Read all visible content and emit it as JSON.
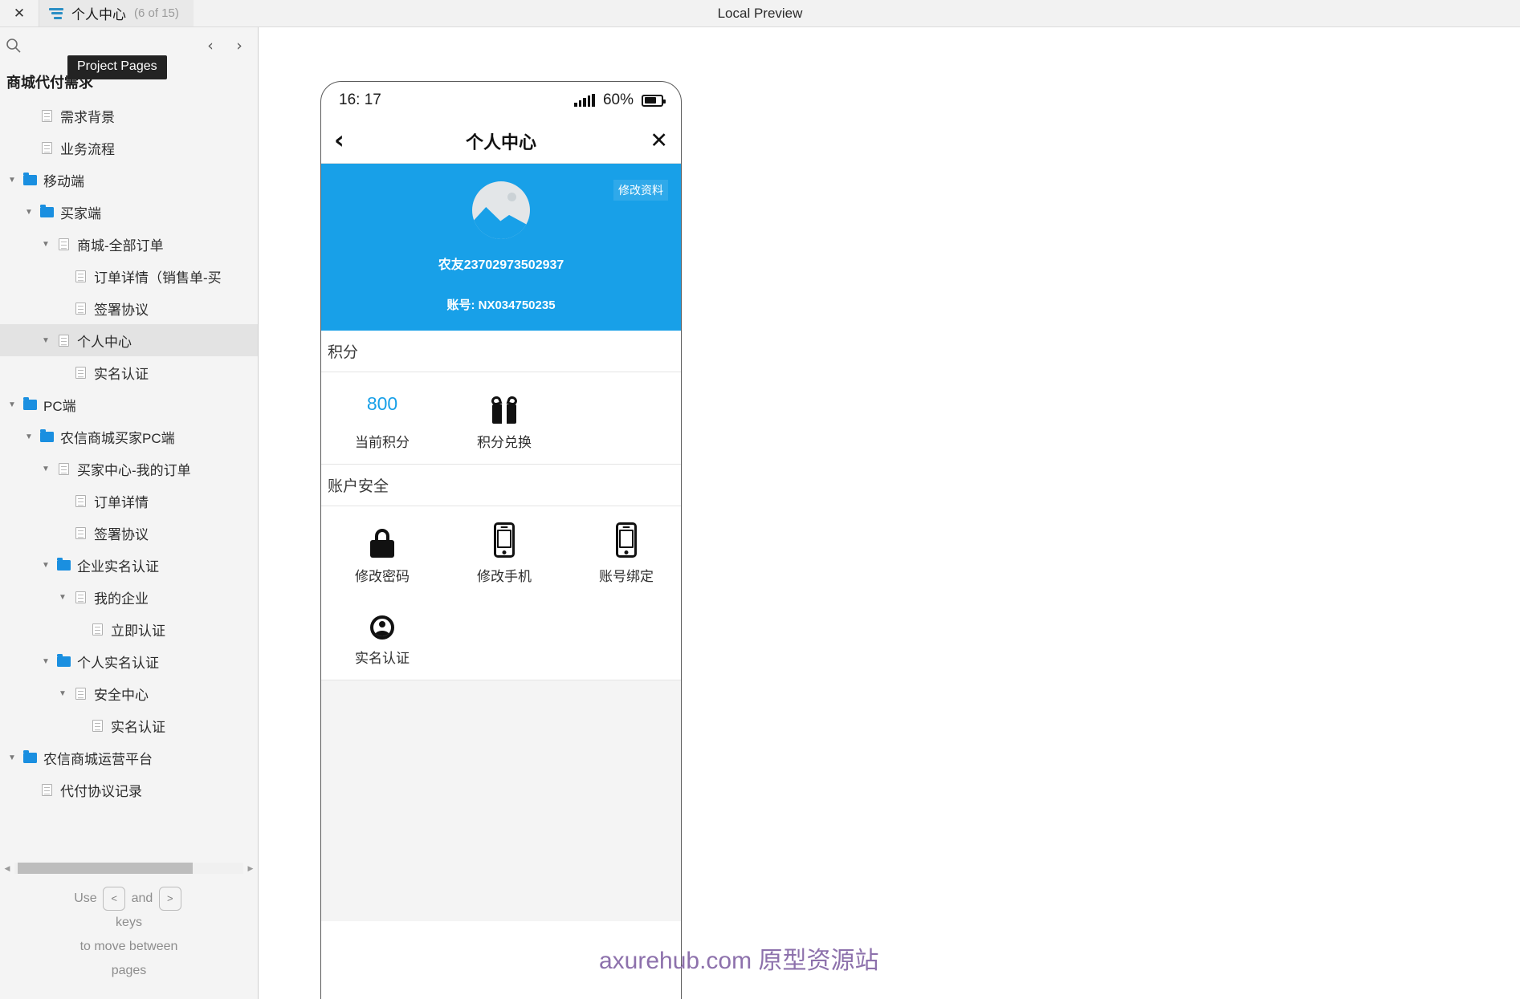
{
  "topbar": {
    "close_label": "✕",
    "tab_icon": "sitemap-icon",
    "tab_title": "个人中心",
    "tab_count": "(6 of 15)",
    "preview_label": "Local Preview"
  },
  "sidebar": {
    "tooltip": "Project Pages",
    "search_icon": "search-icon",
    "prev_arrow": "‹",
    "next_arrow": "›",
    "root_title": "商城代付需求",
    "tree": [
      {
        "label": "需求背景",
        "type": "page",
        "depth": 1,
        "twisty": "",
        "selected": false
      },
      {
        "label": "业务流程",
        "type": "page",
        "depth": 1,
        "twisty": "",
        "selected": false
      },
      {
        "label": "移动端",
        "type": "folder",
        "depth": 0,
        "twisty": "▼",
        "selected": false
      },
      {
        "label": "买家端",
        "type": "folder",
        "depth": 1,
        "twisty": "▼",
        "selected": false
      },
      {
        "label": "商城-全部订单",
        "type": "page",
        "depth": 2,
        "twisty": "▼",
        "selected": false
      },
      {
        "label": "订单详情（销售单-买",
        "type": "page",
        "depth": 3,
        "twisty": "",
        "selected": false
      },
      {
        "label": "签署协议",
        "type": "page",
        "depth": 3,
        "twisty": "",
        "selected": false
      },
      {
        "label": "个人中心",
        "type": "page",
        "depth": 2,
        "twisty": "▼",
        "selected": true
      },
      {
        "label": "实名认证",
        "type": "page",
        "depth": 3,
        "twisty": "",
        "selected": false
      },
      {
        "label": "PC端",
        "type": "folder",
        "depth": 0,
        "twisty": "▼",
        "selected": false
      },
      {
        "label": "农信商城买家PC端",
        "type": "folder",
        "depth": 1,
        "twisty": "▼",
        "selected": false
      },
      {
        "label": "买家中心-我的订单",
        "type": "page",
        "depth": 2,
        "twisty": "▼",
        "selected": false
      },
      {
        "label": "订单详情",
        "type": "page",
        "depth": 3,
        "twisty": "",
        "selected": false
      },
      {
        "label": "签署协议",
        "type": "page",
        "depth": 3,
        "twisty": "",
        "selected": false
      },
      {
        "label": "企业实名认证",
        "type": "folder",
        "depth": 2,
        "twisty": "▼",
        "selected": false
      },
      {
        "label": "我的企业",
        "type": "page",
        "depth": 3,
        "twisty": "▼",
        "selected": false
      },
      {
        "label": "立即认证",
        "type": "page",
        "depth": 4,
        "twisty": "",
        "selected": false
      },
      {
        "label": "个人实名认证",
        "type": "folder",
        "depth": 2,
        "twisty": "▼",
        "selected": false
      },
      {
        "label": "安全中心",
        "type": "page",
        "depth": 3,
        "twisty": "▼",
        "selected": false
      },
      {
        "label": "实名认证",
        "type": "page",
        "depth": 4,
        "twisty": "",
        "selected": false
      },
      {
        "label": "农信商城运营平台",
        "type": "folder",
        "depth": 0,
        "twisty": "▼",
        "selected": false
      },
      {
        "label": "代付协议记录",
        "type": "page",
        "depth": 1,
        "twisty": "",
        "selected": false
      }
    ],
    "hint_use": "Use",
    "hint_and": "and",
    "hint_key_prev": "<",
    "hint_key_next": ">",
    "hint_keys": "keys",
    "hint_line2": "to move between",
    "hint_line3": "pages"
  },
  "preview": {
    "status": {
      "time": "16: 17",
      "battery_percent": "60%",
      "signal_icon": "signal-bars-icon",
      "battery_icon": "battery-icon"
    },
    "nav": {
      "back_icon": "chevron-left-icon",
      "title": "个人中心",
      "close_icon": "close-icon"
    },
    "hero": {
      "edit_button": "修改资料",
      "avatar_icon": "image-placeholder-avatar-icon",
      "username": "农友23702973502937",
      "account": "账号: NX034750235",
      "bg_color": "#18a0e8"
    },
    "points_section": {
      "title": "积分",
      "items": [
        {
          "value": "800",
          "label": "当前积分",
          "icon": "points-value"
        },
        {
          "value": "",
          "label": "积分兑换",
          "icon": "gift-icon"
        }
      ]
    },
    "security_section": {
      "title": "账户安全",
      "items": [
        {
          "label": "修改密码",
          "icon": "lock-icon"
        },
        {
          "label": "修改手机",
          "icon": "mobile-phone-icon"
        },
        {
          "label": "账号绑定",
          "icon": "mobile-phone-icon"
        },
        {
          "label": "实名认证",
          "icon": "person-circle-icon"
        }
      ]
    }
  },
  "watermark": {
    "text": "axurehub.com 原型资源站",
    "color": "#8d71ac"
  }
}
